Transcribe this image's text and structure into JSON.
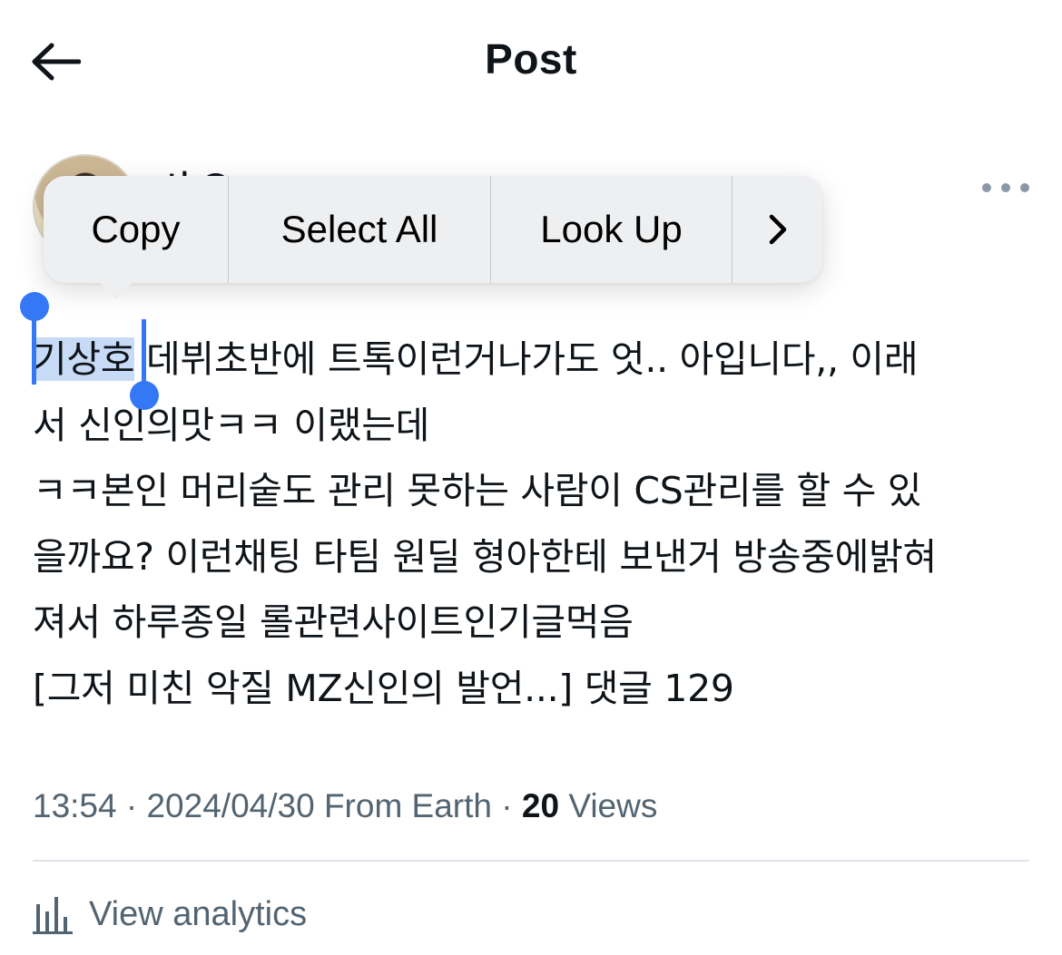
{
  "header": {
    "title": "Post",
    "back_icon": "arrow-left-icon"
  },
  "author": {
    "name": "사 오",
    "avatar_icon": "avatar-image"
  },
  "context_menu": {
    "copy": "Copy",
    "select_all": "Select All",
    "look_up": "Look Up",
    "more_icon": "chevron-right-icon"
  },
  "post": {
    "selected_word": "기상호",
    "lines": [
      " 데뷔초반에 트톡이런거나가도 엇.. 아입니다,, 이래",
      "서 신인의맛ㅋㅋ 이랬는데",
      "ㅋㅋ본인 머리숱도 관리 못하는 사람이 CS관리를 할 수 있",
      "을까요? 이런채팅 타팀 원딜 형아한테 보낸거 방송중에밝혀",
      "져서 하루종일 롤관련사이트인기글먹음",
      "[그저 미친 악질 MZ신인의 발언...] 댓글 129"
    ]
  },
  "meta": {
    "time": "13:54",
    "date": "2024/04/30",
    "source": "From Earth",
    "views_count": "20",
    "views_label": "Views"
  },
  "analytics": {
    "label": "View analytics",
    "icon": "bar-chart-icon"
  },
  "colors": {
    "selection": "#c8dbf6",
    "handle": "#3478f6",
    "secondary_text": "#536471"
  }
}
